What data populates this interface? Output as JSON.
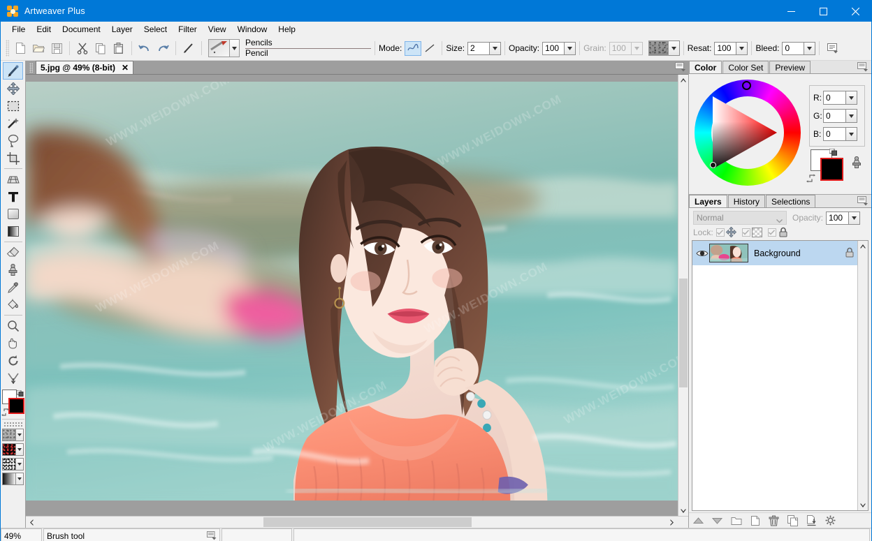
{
  "window": {
    "title": "Artweaver Plus",
    "logo_icon": "flower-logo-icon",
    "minimize_icon": "minimize-icon",
    "maximize_icon": "maximize-icon",
    "close_icon": "close-icon"
  },
  "menubar": {
    "items": [
      {
        "label": "File"
      },
      {
        "label": "Edit"
      },
      {
        "label": "Document"
      },
      {
        "label": "Layer"
      },
      {
        "label": "Select"
      },
      {
        "label": "Filter"
      },
      {
        "label": "View"
      },
      {
        "label": "Window"
      },
      {
        "label": "Help"
      }
    ]
  },
  "toolbar": {
    "buttons": [
      {
        "name": "new-document-button",
        "icon": "new-file-icon"
      },
      {
        "name": "open-document-button",
        "icon": "open-folder-icon"
      },
      {
        "name": "save-document-button",
        "icon": "save-disk-icon"
      },
      {
        "name": "cut-button",
        "icon": "scissors-icon"
      },
      {
        "name": "copy-button",
        "icon": "copy-icon"
      },
      {
        "name": "paste-button",
        "icon": "paste-icon"
      },
      {
        "name": "undo-button",
        "icon": "undo-arrow-icon"
      },
      {
        "name": "redo-button",
        "icon": "redo-arrow-icon"
      },
      {
        "name": "brush-editor-button",
        "icon": "pencil-icon"
      }
    ],
    "brush_preset": {
      "category": "Pencils",
      "variant": "Pencil",
      "swatch_icon": "brush-preset-swatch-icon",
      "dropdown_icon": "chevron-down-icon"
    },
    "options": {
      "mode_label": "Mode:",
      "mode_freehand_icon": "freehand-stroke-icon",
      "mode_line_icon": "straight-line-icon",
      "size_label": "Size:",
      "size_value": "2",
      "opacity_label": "Opacity:",
      "opacity_value": "100",
      "grain_label": "Grain:",
      "grain_value": "100",
      "grain_disabled": true,
      "texture_swatch_icon": "texture-swatch-icon",
      "resat_label": "Resat:",
      "resat_value": "100",
      "bleed_label": "Bleed:",
      "bleed_value": "0",
      "panel_menu_icon": "panel-menu-icon"
    }
  },
  "tools": [
    {
      "name": "tool-brush",
      "icon": "paintbrush-icon",
      "active": true
    },
    {
      "name": "tool-move",
      "icon": "move-arrows-icon",
      "active": false
    },
    {
      "name": "tool-rectangular-select",
      "icon": "rectangular-marquee-icon",
      "active": false
    },
    {
      "name": "tool-magic-wand",
      "icon": "magic-wand-icon",
      "active": false
    },
    {
      "name": "tool-lasso",
      "icon": "lasso-icon",
      "active": false
    },
    {
      "name": "tool-crop",
      "icon": "crop-icon",
      "active": false
    },
    {
      "name": "tool-perspective",
      "icon": "perspective-grid-icon",
      "active": false
    },
    {
      "name": "tool-text",
      "icon": "text-T-icon",
      "active": false
    },
    {
      "name": "tool-shape",
      "icon": "rounded-square-icon",
      "active": false
    },
    {
      "name": "tool-gradient",
      "icon": "gradient-icon",
      "active": false
    },
    {
      "name": "tool-eraser",
      "icon": "eraser-icon",
      "active": false
    },
    {
      "name": "tool-clone-stamp",
      "icon": "clone-stamp-icon",
      "active": false
    },
    {
      "name": "tool-eyedropper",
      "icon": "eyedropper-icon",
      "active": false
    },
    {
      "name": "tool-paint-bucket",
      "icon": "paint-bucket-icon",
      "active": false
    },
    {
      "name": "tool-zoom",
      "icon": "magnifier-icon",
      "active": false
    },
    {
      "name": "tool-hand",
      "icon": "hand-icon",
      "active": false
    },
    {
      "name": "tool-rotate-canvas",
      "icon": "rotate-canvas-icon",
      "active": false
    },
    {
      "name": "tool-smudge",
      "icon": "smudge-arrow-icon",
      "active": false
    }
  ],
  "tool_colors": {
    "foreground": "#ffffff",
    "background": "#000000",
    "swap_icon": "swap-colors-icon",
    "default_icon": "default-colors-icon"
  },
  "tool_textures": [
    {
      "name": "paper-texture-selector",
      "icon": "paper-texture-icon"
    },
    {
      "name": "pattern-selector",
      "icon": "pattern-swatch-icon"
    },
    {
      "name": "noise-texture-selector",
      "icon": "noise-texture-icon"
    },
    {
      "name": "gradient-selector",
      "icon": "gradient-swatch-icon"
    }
  ],
  "document": {
    "tab_label": "5.jpg @ 49% (8-bit)",
    "close_icon": "close-tab-icon",
    "tab_menu_icon": "tab-menu-icon",
    "scroll_up_icon": "chevron-up-icon",
    "scroll_down_icon": "chevron-down-icon",
    "scroll_left_icon": "chevron-left-icon",
    "scroll_right_icon": "chevron-right-icon"
  },
  "color_panel": {
    "tabs": [
      {
        "label": "Color",
        "active": true
      },
      {
        "label": "Color Set",
        "active": false
      },
      {
        "label": "Preview",
        "active": false
      }
    ],
    "menu_icon": "panel-menu-icon",
    "wheel_icon": "color-wheel-icon",
    "channels": [
      {
        "label": "R:",
        "value": "0"
      },
      {
        "label": "G:",
        "value": "0"
      },
      {
        "label": "B:",
        "value": "0"
      }
    ],
    "foreground": "#ffffff",
    "background": "#000000",
    "swap_icon": "swap-colors-icon",
    "default_icon": "default-colors-icon",
    "picker_icon": "color-picker-icon"
  },
  "layers_panel": {
    "tabs": [
      {
        "label": "Layers",
        "active": true
      },
      {
        "label": "History",
        "active": false
      },
      {
        "label": "Selections",
        "active": false
      }
    ],
    "menu_icon": "panel-menu-icon",
    "blend_mode": "Normal",
    "opacity_label": "Opacity:",
    "opacity_value": "100",
    "lock_label": "Lock:",
    "lock_items": [
      {
        "name": "lock-transparency-checkbox",
        "icon": "move-arrows-icon",
        "checked": true
      },
      {
        "name": "lock-pixels-checkbox",
        "icon": "checker-square-icon",
        "checked": true
      },
      {
        "name": "lock-all-checkbox",
        "icon": "padlock-icon",
        "checked": true
      }
    ],
    "layers": [
      {
        "name": "Background",
        "visible": true,
        "locked": true,
        "selected": true,
        "visibility_icon": "eye-icon",
        "lock_icon": "padlock-icon",
        "thumbnail_icon": "layer-thumbnail"
      }
    ],
    "toolbar_buttons": [
      {
        "name": "move-layer-up-button",
        "icon": "triangle-up-icon"
      },
      {
        "name": "move-layer-down-button",
        "icon": "triangle-down-icon"
      },
      {
        "name": "new-group-button",
        "icon": "folder-icon"
      },
      {
        "name": "new-layer-button",
        "icon": "new-page-icon"
      },
      {
        "name": "delete-layer-button",
        "icon": "trash-icon"
      },
      {
        "name": "duplicate-layer-button",
        "icon": "duplicate-icon"
      },
      {
        "name": "merge-down-button",
        "icon": "merge-down-icon"
      },
      {
        "name": "layer-properties-button",
        "icon": "gear-icon"
      }
    ]
  },
  "statusbar": {
    "zoom": "49%",
    "tool": "Brush tool",
    "tool_menu_icon": "panel-menu-icon",
    "extra": ""
  },
  "theme": {
    "accent": "#0078d7",
    "chrome": "#f0f0f0",
    "canvas_backdrop": "#9e9e9e",
    "selection_blue": "#cce4f7",
    "layer_selected": "#bcd7f0",
    "swatch_outline_red": "#e01b1b"
  }
}
